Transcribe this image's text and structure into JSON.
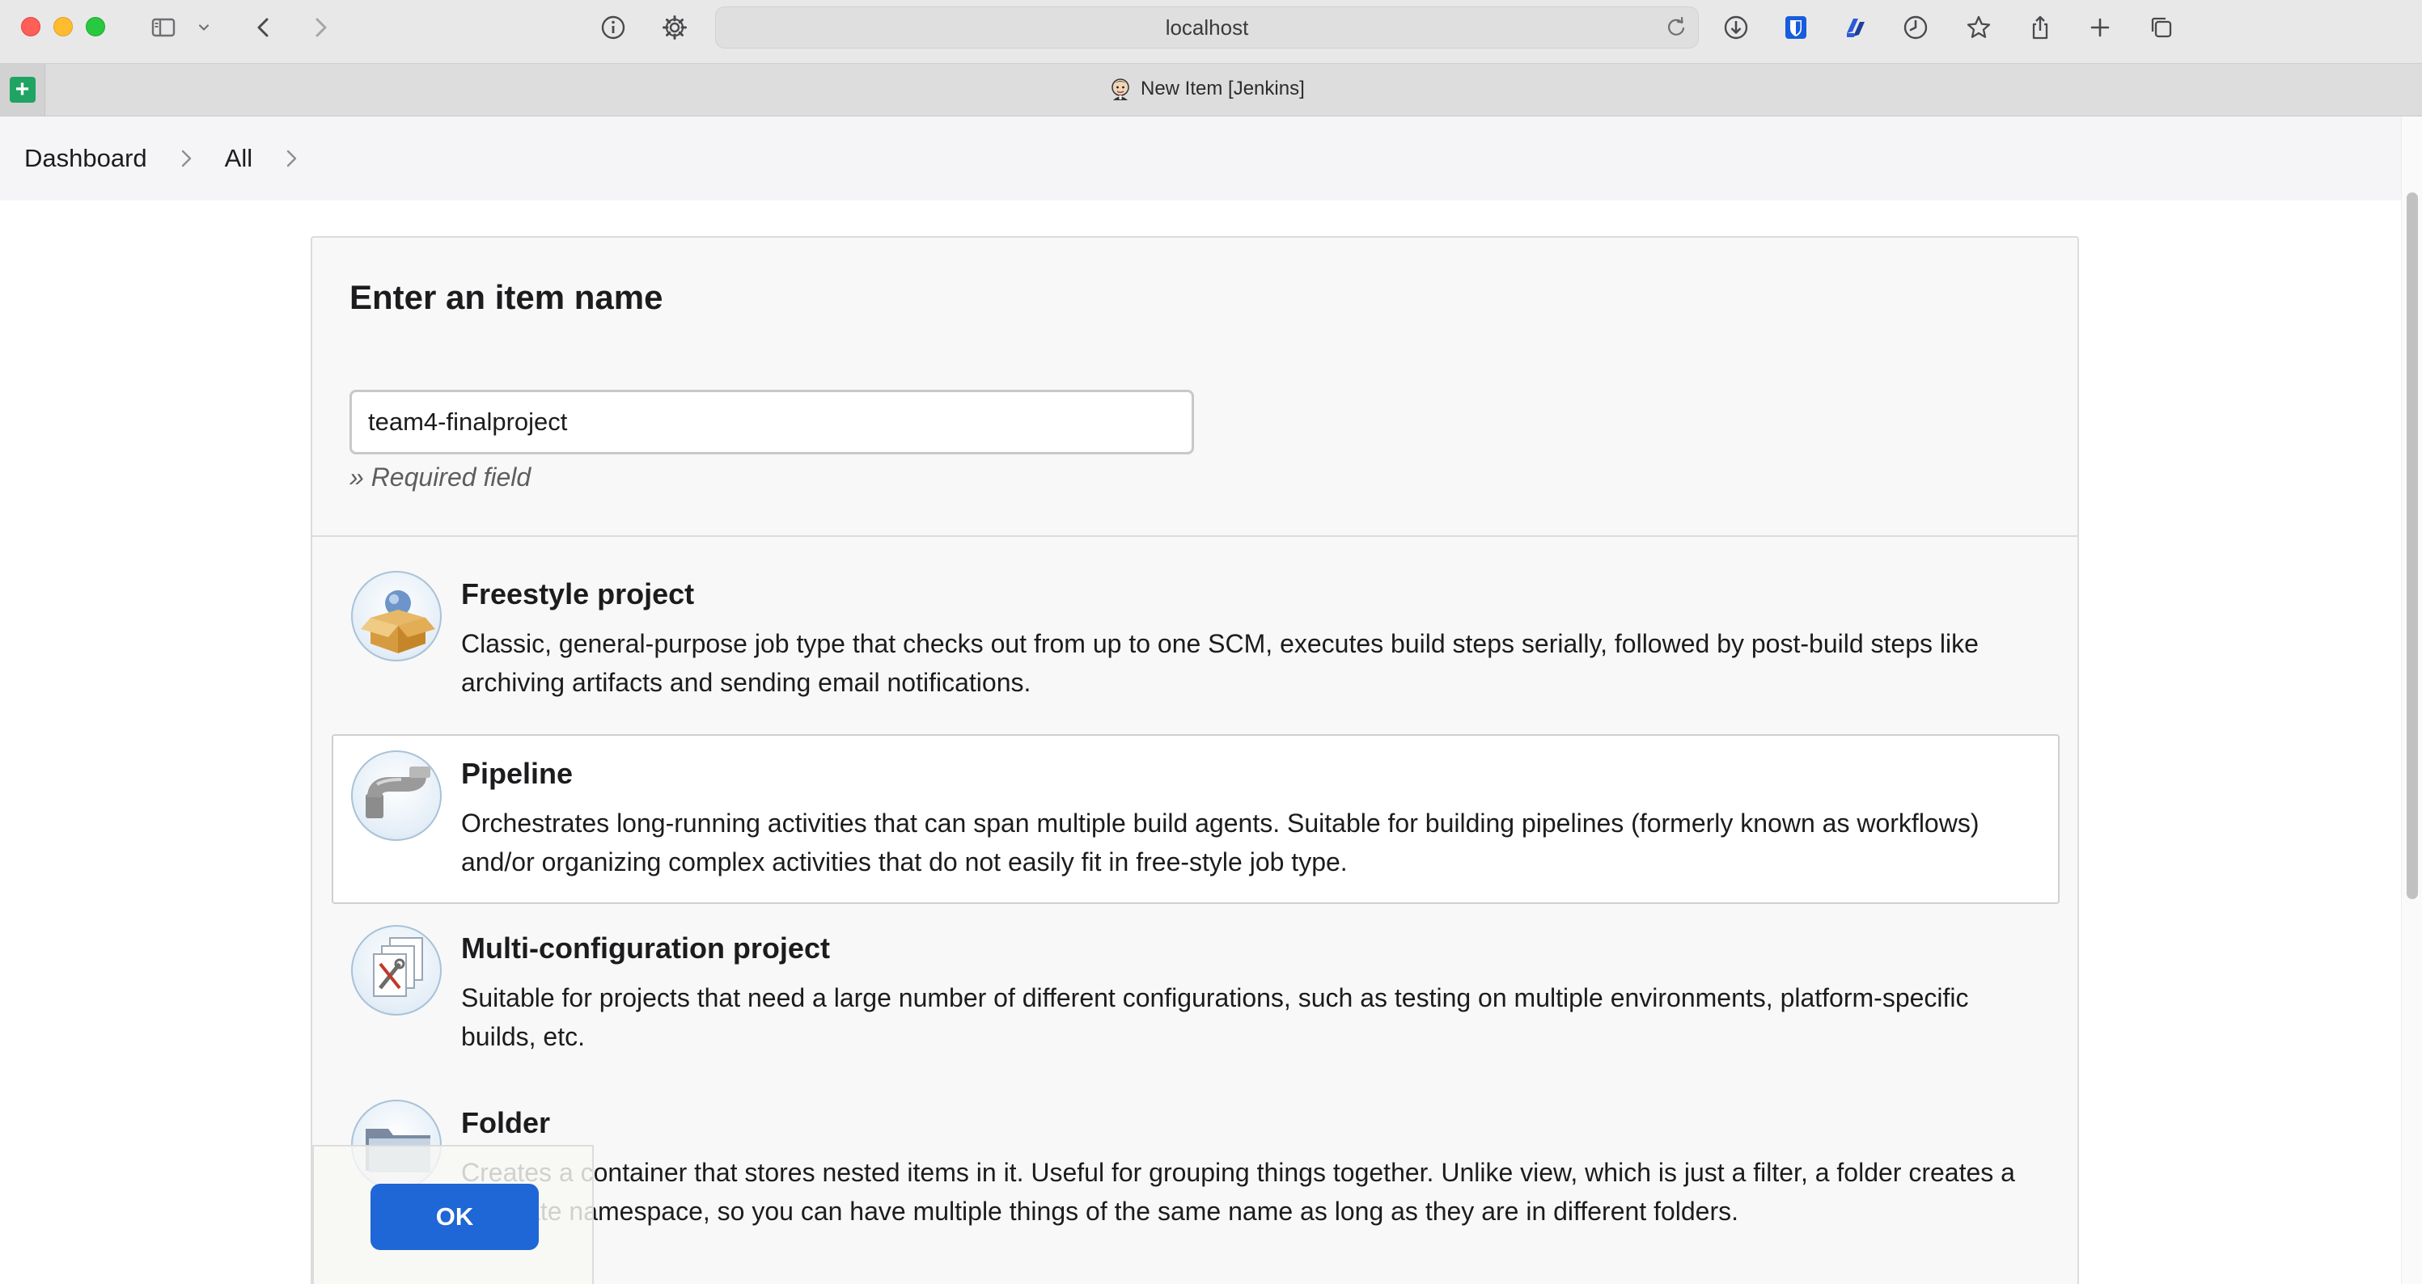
{
  "browser": {
    "url": "localhost",
    "tab_title": "New Item [Jenkins]"
  },
  "breadcrumb": {
    "items": [
      "Dashboard",
      "All"
    ]
  },
  "form": {
    "title": "Enter an item name",
    "item_name_value": "team4-finalproject",
    "required_note": "» Required field"
  },
  "item_types": [
    {
      "name": "Freestyle project",
      "description": "Classic, general-purpose job type that checks out from up to one SCM, executes build steps serially, followed by post-build steps like archiving artifacts and sending email notifications.",
      "icon": "freestyle-box-icon",
      "selected": false
    },
    {
      "name": "Pipeline",
      "description": "Orchestrates long-running activities that can span multiple build agents. Suitable for building pipelines (formerly known as workflows) and/or organizing complex activities that do not easily fit in free-style job type.",
      "icon": "pipeline-pipe-icon",
      "selected": true
    },
    {
      "name": "Multi-configuration project",
      "description": "Suitable for projects that need a large number of different configurations, such as testing on multiple environments, platform-specific builds, etc.",
      "icon": "multi-config-tools-icon",
      "selected": false
    },
    {
      "name": "Folder",
      "description": "Creates a container that stores nested items in it. Useful for grouping things together. Unlike view, which is just a filter, a folder creates a separate namespace, so you can have multiple things of the same name as long as they are in different folders.",
      "icon": "folder-icon",
      "selected": false
    }
  ],
  "actions": {
    "ok_label": "OK"
  },
  "colors": {
    "ok_button": "#1f66d6",
    "panel_bg": "#f8f8f8",
    "breadcrumb_bg": "#f5f5f7"
  }
}
